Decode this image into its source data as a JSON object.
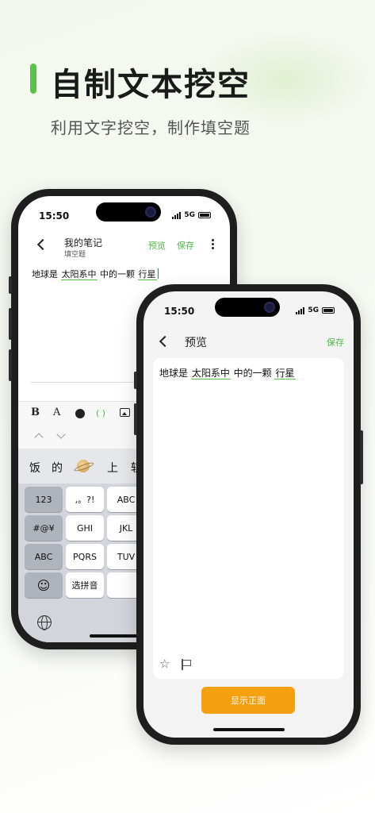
{
  "hero": {
    "title": "自制文本挖空",
    "subtitle": "利用文字挖空，制作填空题",
    "accent_color": "#5cc14a"
  },
  "status_bar": {
    "time": "15:50",
    "network": "5G",
    "icons": [
      "signal-icon",
      "battery-icon"
    ]
  },
  "editor_screen": {
    "header": {
      "title": "我的笔记",
      "subtitle": "填空题",
      "preview_label": "预览",
      "save_label": "保存",
      "icons": [
        "back-icon",
        "more-icon"
      ]
    },
    "note": {
      "segments": [
        {
          "text": "地球是 ",
          "blank": false
        },
        {
          "text": "太阳系中",
          "blank": true
        },
        {
          "text": " 中的一颗 ",
          "blank": false
        },
        {
          "text": "行星",
          "blank": true
        }
      ]
    },
    "toolbar": {
      "bold_label": "B",
      "font_label": "A",
      "cloze_label": "( )",
      "icons": [
        "bold-icon",
        "font-icon",
        "color-dot-icon",
        "cloze-icon",
        "image-icon",
        "chevron-up-icon",
        "chevron-down-icon"
      ]
    },
    "keyboard": {
      "candidates": [
        "饭",
        "的",
        "上",
        "轨"
      ],
      "candidate_icon": "planet-emoji-icon",
      "keys": [
        {
          "label": "123",
          "style": "dark"
        },
        {
          "label": ",。?!",
          "style": "light"
        },
        {
          "label": "ABC",
          "style": "light"
        },
        {
          "label": "#@¥",
          "style": "dark"
        },
        {
          "label": "GHI",
          "style": "light"
        },
        {
          "label": "JKL",
          "style": "light"
        },
        {
          "label": "ABC",
          "style": "dark"
        },
        {
          "label": "PQRS",
          "style": "light"
        },
        {
          "label": "TUV",
          "style": "light"
        },
        {
          "label": "",
          "style": "dark"
        },
        {
          "label": "选拼音",
          "style": "light"
        },
        {
          "label": "",
          "style": "light"
        }
      ],
      "icons": [
        "emoji-icon",
        "globe-icon"
      ]
    }
  },
  "preview_screen": {
    "header": {
      "title": "预览",
      "save_label": "保存",
      "icons": [
        "back-icon"
      ]
    },
    "card": {
      "segments": [
        {
          "text": "地球是 ",
          "blank": false
        },
        {
          "text": "太阳系中",
          "blank": true
        },
        {
          "text": " 中的一颗 ",
          "blank": false
        },
        {
          "text": "行星",
          "blank": true
        }
      ],
      "icons": [
        "star-icon",
        "flag-icon"
      ]
    },
    "primary_button": {
      "label": "显示正面",
      "color": "#f4a010"
    }
  }
}
